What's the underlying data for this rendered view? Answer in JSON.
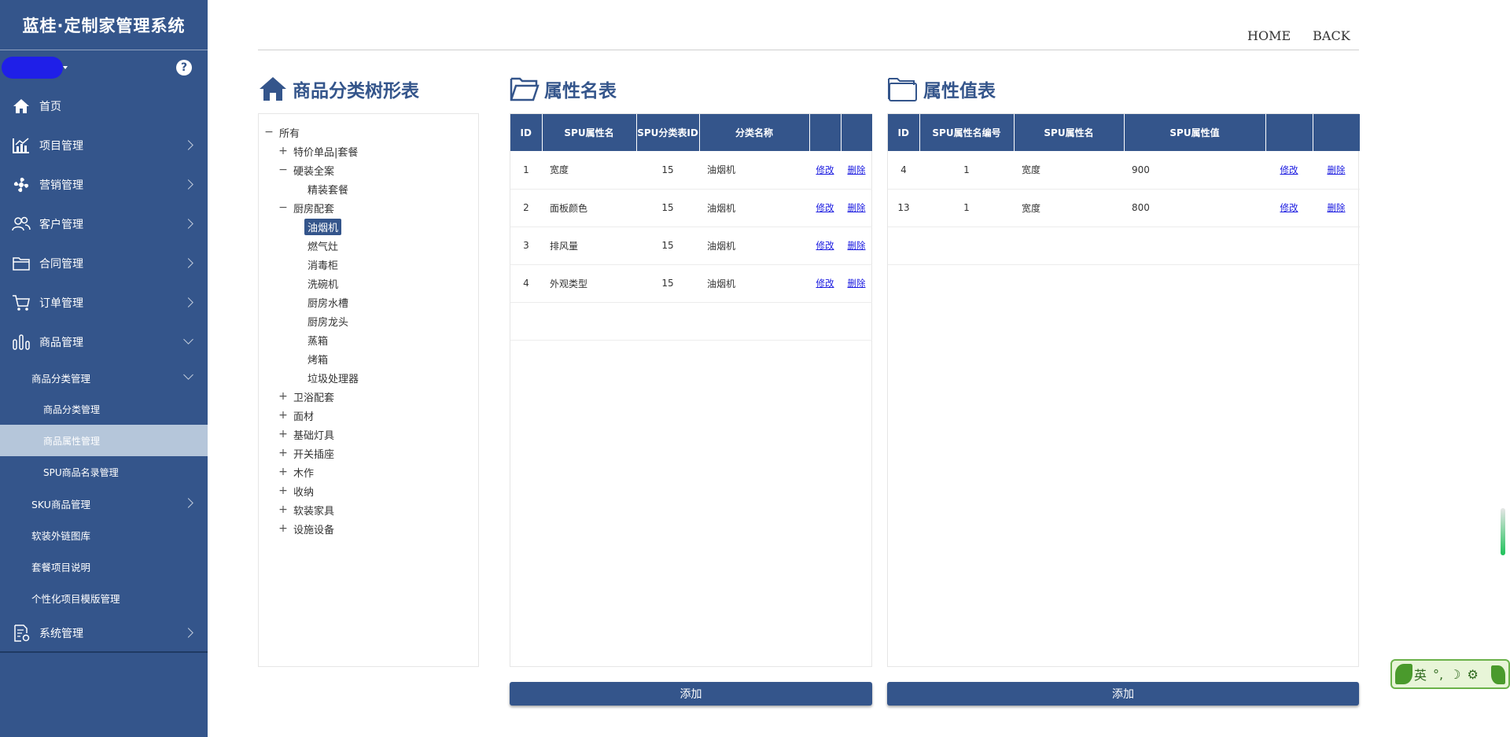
{
  "app": {
    "title": "蓝桂·定制家管理系统",
    "help": "?"
  },
  "sidebar": {
    "items": [
      {
        "label": "首页",
        "icon": "home-icon"
      },
      {
        "label": "项目管理",
        "icon": "chart-icon"
      },
      {
        "label": "营销管理",
        "icon": "fan-icon"
      },
      {
        "label": "客户管理",
        "icon": "users-icon"
      },
      {
        "label": "合同管理",
        "icon": "folder-icon"
      },
      {
        "label": "订单管理",
        "icon": "cart-icon"
      },
      {
        "label": "商品管理",
        "icon": "bars-icon"
      }
    ],
    "goods_sub": {
      "category_group": "商品分类管理",
      "category_manage": "商品分类管理",
      "attribute_manage": "商品属性管理",
      "spu_manage": "SPU商品名录管理",
      "sku_manage": "SKU商品管理",
      "soft_links": "软装外链图库",
      "package_desc": "套餐项目说明",
      "personal_template": "个性化项目模版管理"
    },
    "system": {
      "label": "系统管理",
      "icon": "doc-gear-icon"
    }
  },
  "topbar": {
    "home": "HOME",
    "back": "BACK"
  },
  "tree": {
    "title": "商品分类树形表",
    "nodes": [
      {
        "label": "所有",
        "toggle": "−"
      },
      {
        "label": "特价单品|套餐",
        "toggle": "+"
      },
      {
        "label": "硬装全案",
        "toggle": "−"
      },
      {
        "label": "精装套餐",
        "toggle": ""
      },
      {
        "label": "厨房配套",
        "toggle": "−"
      },
      {
        "label": "油烟机",
        "toggle": ""
      },
      {
        "label": "燃气灶",
        "toggle": ""
      },
      {
        "label": "消毒柜",
        "toggle": ""
      },
      {
        "label": "洗碗机",
        "toggle": ""
      },
      {
        "label": "厨房水槽",
        "toggle": ""
      },
      {
        "label": "厨房龙头",
        "toggle": ""
      },
      {
        "label": "蒸箱",
        "toggle": ""
      },
      {
        "label": "烤箱",
        "toggle": ""
      },
      {
        "label": "垃圾处理器",
        "toggle": ""
      },
      {
        "label": "卫浴配套",
        "toggle": "+"
      },
      {
        "label": "面材",
        "toggle": "+"
      },
      {
        "label": "基础灯具",
        "toggle": "+"
      },
      {
        "label": "开关插座",
        "toggle": "+"
      },
      {
        "label": "木作",
        "toggle": "+"
      },
      {
        "label": "收纳",
        "toggle": "+"
      },
      {
        "label": "软装家具",
        "toggle": "+"
      },
      {
        "label": "设施设备",
        "toggle": "+"
      }
    ]
  },
  "attr_names": {
    "title": "属性名表",
    "headers": [
      "ID",
      "SPU属性名",
      "SPU分类表ID",
      "分类名称",
      "",
      ""
    ],
    "rows": [
      {
        "id": "1",
        "name": "宽度",
        "cat_id": "15",
        "cat_name": "油烟机",
        "edit": "修改",
        "del": "删除"
      },
      {
        "id": "2",
        "name": "面板颜色",
        "cat_id": "15",
        "cat_name": "油烟机",
        "edit": "修改",
        "del": "删除"
      },
      {
        "id": "3",
        "name": "排风量",
        "cat_id": "15",
        "cat_name": "油烟机",
        "edit": "修改",
        "del": "删除"
      },
      {
        "id": "4",
        "name": "外观类型",
        "cat_id": "15",
        "cat_name": "油烟机",
        "edit": "修改",
        "del": "删除"
      }
    ],
    "add": "添加"
  },
  "attr_values": {
    "title": "属性值表",
    "headers": [
      "ID",
      "SPU属性名编号",
      "SPU属性名",
      "SPU属性值",
      "",
      ""
    ],
    "rows": [
      {
        "id": "4",
        "name_no": "1",
        "name": "宽度",
        "value": "900",
        "edit": "修改",
        "del": "删除"
      },
      {
        "id": "13",
        "name_no": "1",
        "name": "宽度",
        "value": "800",
        "edit": "修改",
        "del": "删除"
      }
    ],
    "add": "添加"
  },
  "ime": {
    "label": "英"
  }
}
